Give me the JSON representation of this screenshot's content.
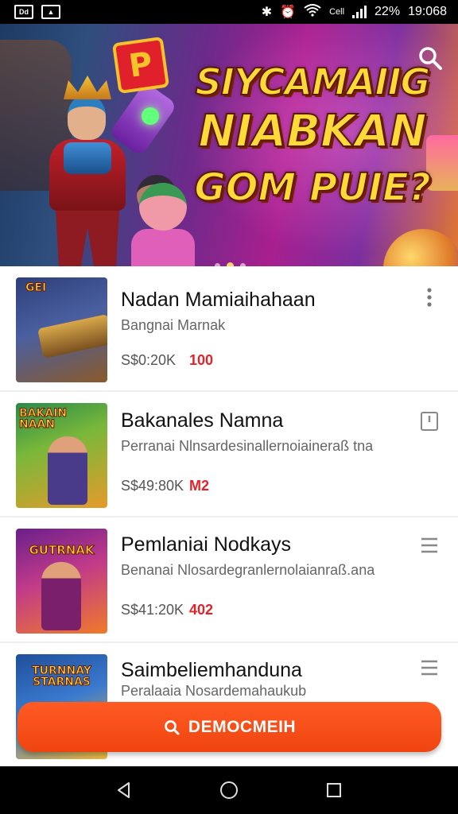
{
  "status_bar": {
    "left_icons": [
      "notification-icon",
      "image-icon"
    ],
    "right_text": "22%",
    "carrier": "Cell",
    "time": "19:068"
  },
  "hero": {
    "title_line1": "SIYCAMAIIG",
    "title_line2": "NIABKAN",
    "title_line3": "GOM PUIE?",
    "logo": "P",
    "dots": 3,
    "active_dot": 1
  },
  "games": [
    {
      "title": "Nadan Mamiaihahaan",
      "subtitle": "Bangnai Marnak",
      "price": "S$0:20K",
      "badge": "100",
      "action": "more-vert-icon",
      "thumb_caption": "GEI",
      "thumb_colors": [
        "#2d3f7a",
        "#8a5a2a"
      ]
    },
    {
      "title": "Bakanales Namna",
      "subtitle": "Perranai Nlnsardesinallernoiaineraß tna",
      "price": "S$49:80K",
      "badge": "M2",
      "action": "bookmark-icon",
      "thumb_caption": "BAKAIN NAAN",
      "thumb_colors": [
        "#2a8a4a",
        "#e59a2a"
      ]
    },
    {
      "title": "Pemlaniai Nodkays",
      "subtitle": "Benanai Nlosardegranlernolaianraß.ana",
      "price": "S$41:20K",
      "badge": "402",
      "action": "list-icon",
      "thumb_caption": "GUTRNAK",
      "thumb_colors": [
        "#6a1f8a",
        "#f07a2a"
      ]
    },
    {
      "title": "Saimbeliemhanduna",
      "subtitle": "Peralaaia Nosardemahaukub",
      "price": "",
      "badge": "",
      "action": "list-icon",
      "thumb_caption": "TURNNAY STARNAS",
      "thumb_colors": [
        "#1f4f9a",
        "#f0b83a"
      ]
    }
  ],
  "fab": {
    "label": "DEMOCMEIH"
  },
  "nav": [
    "back-icon",
    "home-icon",
    "recents-icon"
  ],
  "colors": {
    "accent": "#f0440f",
    "badge": "#e0242a",
    "title_yellow": "#ffd83a"
  }
}
